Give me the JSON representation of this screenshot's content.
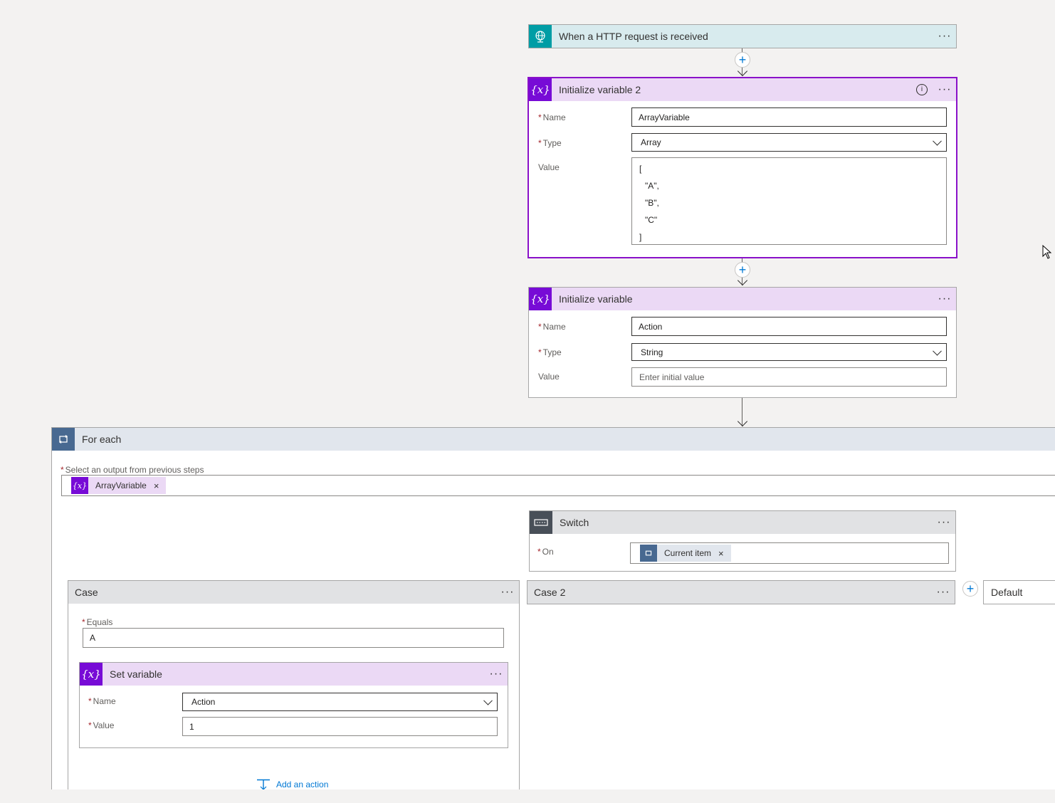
{
  "trigger": {
    "title": "When a HTTP request is received",
    "more": "···"
  },
  "init2": {
    "title": "Initialize variable 2",
    "more": "···",
    "info": "i",
    "name_label": "Name",
    "name_value": "ArrayVariable",
    "type_label": "Type",
    "type_value": "Array",
    "value_label": "Value",
    "value_lines": [
      "[",
      "\"A\",",
      "\"B\",",
      "\"C\"",
      "]"
    ]
  },
  "init1": {
    "title": "Initialize variable",
    "more": "···",
    "name_label": "Name",
    "name_value": "Action",
    "type_label": "Type",
    "type_value": "String",
    "value_label": "Value",
    "value_placeholder": "Enter initial value"
  },
  "foreach": {
    "title": "For each",
    "select_label": "Select an output from previous steps",
    "token_label": "ArrayVariable",
    "token_remove": "×"
  },
  "switch": {
    "title": "Switch",
    "more": "···",
    "on_label": "On",
    "token_label": "Current item",
    "token_remove": "×"
  },
  "case1": {
    "title": "Case",
    "more": "···",
    "equals_label": "Equals",
    "equals_value": "A",
    "add_action": "Add an action"
  },
  "set_variable": {
    "title": "Set variable",
    "more": "···",
    "name_label": "Name",
    "name_value": "Action",
    "value_label": "Value",
    "value_value": "1"
  },
  "case2": {
    "title": "Case 2",
    "more": "···"
  },
  "default_case": {
    "title": "Default"
  },
  "required_mark": "*",
  "icons": {
    "variable": "{x}",
    "http": "globe-icon",
    "loop": "loop-icon",
    "switch": "switch-icon"
  },
  "colors": {
    "variable_accent": "#770bd6",
    "variable_header": "#ebd9f5",
    "http_accent": "#009da5",
    "http_header": "#d8ebee",
    "loop_accent": "#486991",
    "loop_header": "#e1e6ed",
    "switch_accent": "#484f58",
    "selected_border": "#8a11c9",
    "link": "#0078d4"
  }
}
